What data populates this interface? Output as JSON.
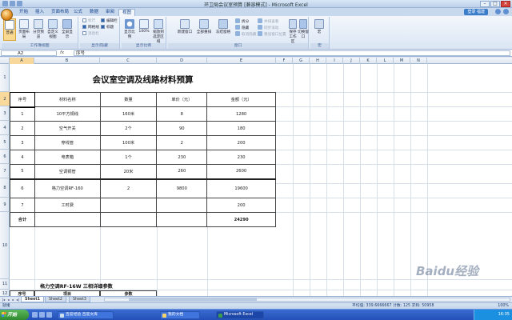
{
  "window": {
    "title": "环卫局会议室预算 [兼容模式] - Microsoft Excel",
    "minimize": "–",
    "maximize": "□",
    "close": "×"
  },
  "ribbon": {
    "tabs": [
      "开始",
      "插入",
      "页面布局",
      "公式",
      "数据",
      "审阅",
      "视图"
    ],
    "active_tab": "视图",
    "login_label": "登录 福建",
    "groups": {
      "workbook_views": {
        "label": "工作簿视图",
        "normal": "普通",
        "page_layout": "页面布局",
        "page_break": "分页预览",
        "custom": "自定义视图",
        "fullscreen": "全屏显示"
      },
      "show_hide": {
        "label": "显示/隐藏",
        "ruler": "标尺",
        "gridlines": "网格线",
        "message_bar": "消息栏",
        "formula_bar": "编辑栏",
        "headings": "标题"
      },
      "zoom": {
        "label": "显示比例",
        "zoom": "显示比例",
        "hundred": "100%",
        "zoom_selection": "缩放到选定区域"
      },
      "window": {
        "label": "窗口",
        "new_window": "新建窗口",
        "arrange_all": "全部重排",
        "freeze": "冻结窗格",
        "split": "拆分",
        "hide": "隐藏",
        "unhide": "取消隐藏",
        "side_by_side": "并排查看",
        "sync_scroll": "同步滚动",
        "reset_position": "重设窗口位置",
        "save_workspace": "保存工作区",
        "switch_windows": "切换窗口"
      },
      "macros": {
        "label": "宏",
        "macros": "宏"
      }
    }
  },
  "formula_bar": {
    "cell_ref": "A2",
    "fx": "fx",
    "value": "序号"
  },
  "grid": {
    "columns": [
      "A",
      "B",
      "C",
      "D",
      "E",
      "F",
      "G",
      "H",
      "I",
      "J",
      "K",
      "L",
      "M",
      "N"
    ],
    "rows": [
      "1",
      "2",
      "3",
      "4",
      "5",
      "6",
      "7",
      "8",
      "9",
      "10",
      "11",
      "12"
    ],
    "active_col": "A",
    "active_row": "2"
  },
  "sheet": {
    "title": "会议室空调及线路材料预算",
    "headers": [
      "序号",
      "材料名称",
      "数量",
      "单价（元）",
      "金额（元）"
    ],
    "rows": [
      [
        "1",
        "10平方铜线",
        "160米",
        "8",
        "1280"
      ],
      [
        "2",
        "空气开关",
        "2个",
        "90",
        "180"
      ],
      [
        "3",
        "穿线管",
        "100米",
        "2",
        "200"
      ],
      [
        "4",
        "电表箱",
        "1个",
        "230",
        "230"
      ],
      [
        "5",
        "空调铜管",
        "20米",
        "260",
        "2600"
      ],
      [
        "6",
        "格力空调RF-160",
        "2",
        "9800",
        "19600"
      ],
      [
        "7",
        "工时费",
        "",
        "",
        "200"
      ]
    ],
    "total_label": "合计",
    "total_value": "24290",
    "subtitle": "格力空调RF-16W 三相详细参数",
    "sub_headers": [
      "序号",
      "项目",
      "参数"
    ]
  },
  "sheet_tabs": [
    "Sheet1",
    "Sheet2",
    "Sheet3"
  ],
  "status": {
    "ready": "就绪",
    "stats": "平均值: 339.6666667   计数: 125   求和: 50958",
    "zoom": "100%"
  },
  "taskbar": {
    "start": "开始",
    "items": [
      "百度经验 百度文库",
      "Microsoft Excel",
      "我的文档"
    ],
    "clock": "16:35"
  },
  "watermark": "Baidu经验"
}
